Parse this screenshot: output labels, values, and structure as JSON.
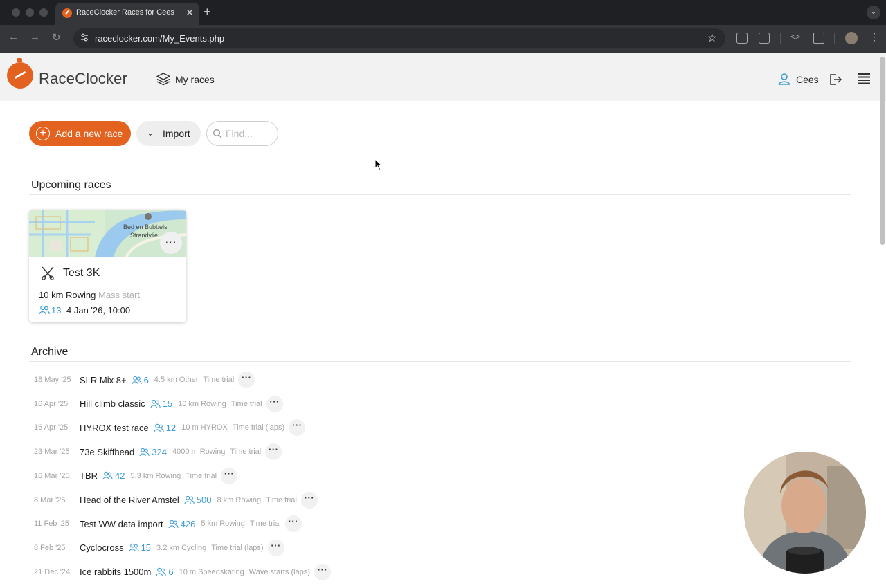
{
  "browser": {
    "tab_title": "RaceClocker Races for Cees",
    "tab_close": "✕",
    "new_tab": "+",
    "url": "raceclocker.com/My_Events.php"
  },
  "header": {
    "brand": "RaceClocker",
    "nav_label": "My races",
    "user_name": "Cees"
  },
  "actions": {
    "add_label": "Add a new race",
    "import_label": "Import",
    "find_placeholder": "Find..."
  },
  "upcoming": {
    "title": "Upcoming races",
    "races": [
      {
        "name": "Test 3K",
        "distance": "10 km Rowing",
        "start_type": "Mass start",
        "participants": "13",
        "datetime": "4 Jan '26, 10:00",
        "map_labels": [
          "Bed en Bubbels",
          "Strandvlie"
        ]
      }
    ]
  },
  "archive": {
    "title": "Archive",
    "rows": [
      {
        "date": "18 May '25",
        "name": "SLR Mix 8+",
        "count": "6",
        "dist": "4.5 km Other",
        "type": "Time trial"
      },
      {
        "date": "16 Apr '25",
        "name": "Hill climb classic",
        "count": "15",
        "dist": "10 km Rowing",
        "type": "Time trial"
      },
      {
        "date": "16 Apr '25",
        "name": "HYROX test race",
        "count": "12",
        "dist": "10 m HYROX",
        "type": "Time trial (laps)"
      },
      {
        "date": "23 Mar '25",
        "name": "73e Skiffhead",
        "count": "324",
        "dist": "4000 m Rowing",
        "type": "Time trial"
      },
      {
        "date": "16 Mar '25",
        "name": "TBR",
        "count": "42",
        "dist": "5.3 km Rowing",
        "type": "Time trial"
      },
      {
        "date": "8 Mar '25",
        "name": "Head of the River Amstel",
        "count": "500",
        "dist": "8 km Rowing",
        "type": "Time trial"
      },
      {
        "date": "11 Feb '25",
        "name": "Test WW data import",
        "count": "426",
        "dist": "5 km Rowing",
        "type": "Time trial"
      },
      {
        "date": "8 Feb '25",
        "name": "Cyclocross",
        "count": "15",
        "dist": "3.2 km Cycling",
        "type": "Time trial (laps)"
      },
      {
        "date": "21 Dec '24",
        "name": "Ice rabbits 1500m",
        "count": "6",
        "dist": "10 m Speedskating",
        "type": "Wave starts (laps)"
      }
    ]
  },
  "more_glyph": "···",
  "colors": {
    "brand_orange": "#e4621f",
    "count_blue": "#3a9ad9",
    "muted_gray": "#a5a5a5"
  },
  "icons": [
    "layers-icon",
    "user-icon",
    "logout-icon",
    "menu-icon",
    "search-icon",
    "rowing-icon",
    "people-icon",
    "more-icon"
  ]
}
